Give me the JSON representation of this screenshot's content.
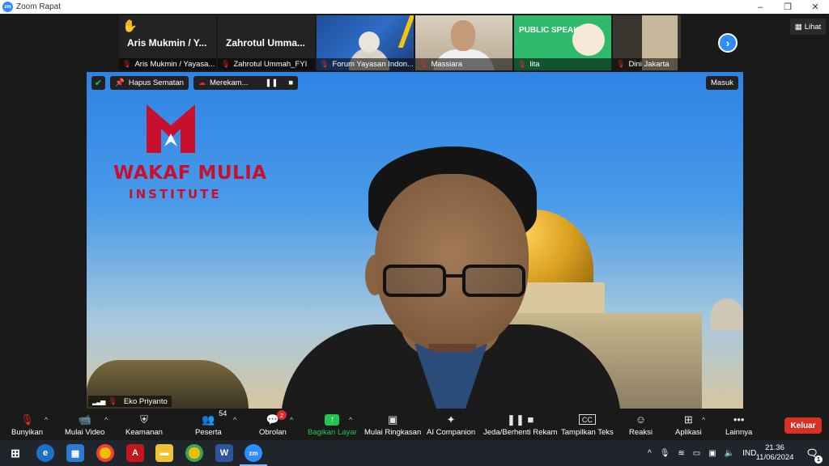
{
  "window": {
    "title": "Zoom Rapat",
    "app_logo": "zm",
    "controls": [
      "–",
      "❐",
      "✕"
    ]
  },
  "thumbnails": [
    {
      "big_name": "Aris Mukmin / Y...",
      "caption": "Aris Mukmin / Yayasa...",
      "hand_raised": true
    },
    {
      "big_name": "Zahrotul  Umma...",
      "caption": "Zahrotul Ummah_FYI"
    },
    {
      "caption": "Forum Yayasan Indon..."
    },
    {
      "caption": "Massiara"
    },
    {
      "caption": "lita",
      "content": "PUBLIC SPEAKING."
    },
    {
      "caption": "Dini Jakarta"
    }
  ],
  "view_button": "Lihat",
  "video": {
    "pill_unpin": "Hapus Sematan",
    "pill_recording": "Merekam...",
    "enter_button": "Masuk",
    "logo_line1": "WAKAF MULIA",
    "logo_line2": "INSTITUTE",
    "speaker_name": "Eko Priyanto"
  },
  "toolbar": {
    "unmute": "Bunyikan",
    "start_video": "Mulai Video",
    "security": "Keamanan",
    "participants": "Peserta",
    "participants_count": "54",
    "chat": "Obrolan",
    "chat_badge": "2",
    "share_screen": "Bagikan Layar",
    "summary": "Mulai Ringkasan",
    "ai_companion": "AI Companion",
    "pause_recording": "Jeda/Berhenti Rekam",
    "captions": "Tampilkan Teks",
    "reactions": "Reaksi",
    "apps": "Aplikasi",
    "more": "Lainnya",
    "leave": "Keluar"
  },
  "taskbar": {
    "language": "IND",
    "time": "21.36",
    "date": "11/06/2024",
    "notification_count": "1",
    "word_icon": "W",
    "zoom_icon": "zm"
  },
  "colors": {
    "accent": "#2d8cff",
    "share_green": "#23c552",
    "leave_red": "#d93025",
    "logo_red": "#c8102e"
  }
}
